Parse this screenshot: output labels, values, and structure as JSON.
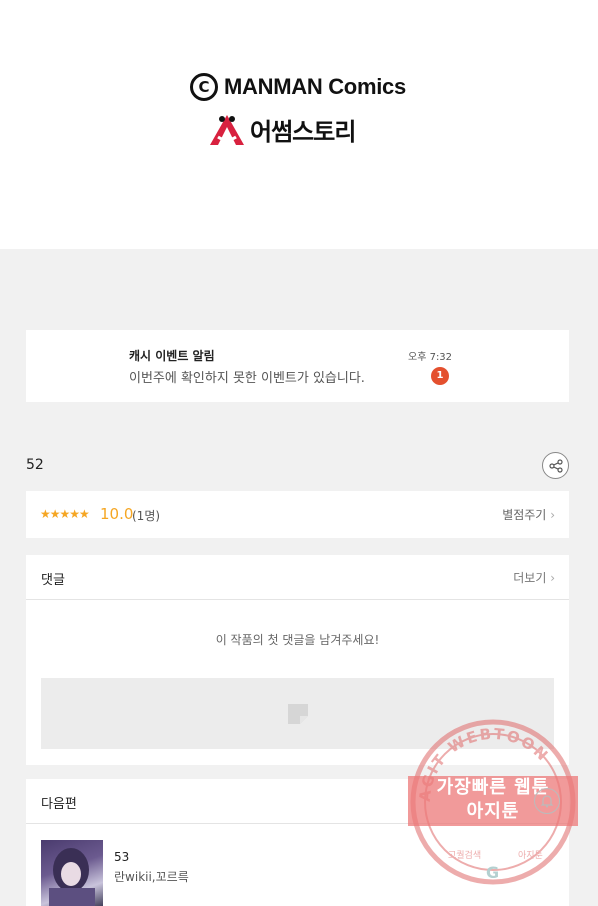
{
  "banner": {
    "brand": "MANMAN Comics",
    "copyright_mark": "C",
    "story_name": "어썸스토리"
  },
  "notice": {
    "title": "캐시 이벤트 알림",
    "body": "이번주에 확인하지 못한 이벤트가 있습니다.",
    "time": "오후 7:32",
    "badge_count": "1"
  },
  "episode": {
    "title": "52"
  },
  "rating": {
    "stars": "★★★★★",
    "score": "10.0",
    "count": "(1명)",
    "rate_label": "별점주기",
    "star_color": "#f5a623"
  },
  "comments": {
    "title": "댓글",
    "more_label": "더보기",
    "empty_message": "이 작품의 첫 댓글을 남겨주세요!"
  },
  "next": {
    "title": "다음편",
    "item": {
      "number": "53",
      "author": "란wikii,꼬르륵"
    }
  },
  "watermark": {
    "arc_text": "AGIT WEBTOON",
    "line1": "가장빠른 웹툰",
    "line2": "아지툰",
    "bottom_left": "고퀄검색",
    "bottom_right": "아지툰",
    "center_mark": "G"
  }
}
